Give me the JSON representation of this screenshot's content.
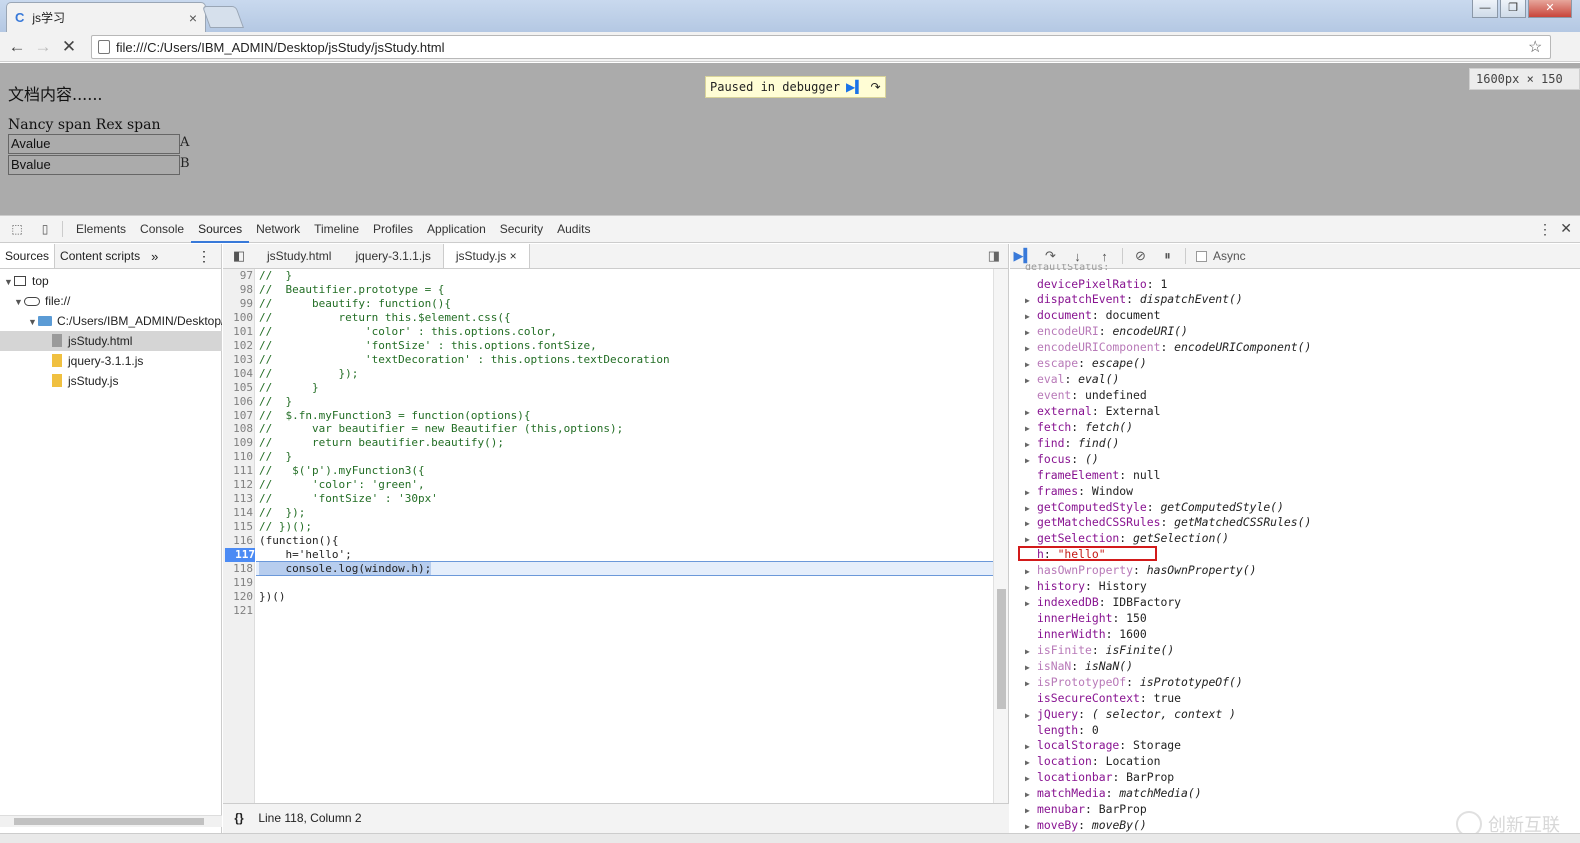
{
  "browser": {
    "tab_title": "js学习",
    "tab_close": "×",
    "url": "file:///C:/Users/IBM_ADMIN/Desktop/jsStudy/jsStudy.html",
    "win_min": "—",
    "win_max": "❐",
    "win_close": "✕"
  },
  "page": {
    "doc_text": "文档内容......",
    "spans_text": "Nancy span Rex span",
    "inputs": [
      {
        "value": "Avalue",
        "label": "A"
      },
      {
        "value": "Bvalue",
        "label": "B"
      }
    ],
    "paused_text": "Paused in debugger",
    "viewport_size": "1600px × 150"
  },
  "devtools": {
    "tabs": [
      "Elements",
      "Console",
      "Sources",
      "Network",
      "Timeline",
      "Profiles",
      "Application",
      "Security",
      "Audits"
    ],
    "active_tab": "Sources",
    "navigator": {
      "tabs": [
        "Sources",
        "Content scripts"
      ],
      "more": "»",
      "tree": [
        {
          "label": "top"
        },
        {
          "label": "file://"
        },
        {
          "label": "C:/Users/IBM_ADMIN/Desktop/jsStudy"
        },
        {
          "label": "jsStudy.html"
        },
        {
          "label": "jquery-3.1.1.js"
        },
        {
          "label": "jsStudy.js"
        }
      ]
    },
    "editor": {
      "tabs": [
        "jsStudy.html",
        "jquery-3.1.1.js",
        "jsStudy.js"
      ],
      "active_file": "jsStudy.js",
      "tab_close": "×",
      "status": "Line 118, Column 2",
      "format_button": "{}",
      "breakpoint_line": 117,
      "exec_line": 118,
      "lines": [
        {
          "n": "97",
          "text": "//  }"
        },
        {
          "n": "98",
          "text": "//  Beautifier.prototype = {"
        },
        {
          "n": "99",
          "text": "//      beautify: function(){"
        },
        {
          "n": "100",
          "text": "//          return this.$element.css({"
        },
        {
          "n": "101",
          "text": "//              'color' : this.options.color,"
        },
        {
          "n": "102",
          "text": "//              'fontSize' : this.options.fontSize,"
        },
        {
          "n": "103",
          "text": "//              'textDecoration' : this.options.textDecoration"
        },
        {
          "n": "104",
          "text": "//          });"
        },
        {
          "n": "105",
          "text": "//      }"
        },
        {
          "n": "106",
          "text": "//  }"
        },
        {
          "n": "107",
          "text": "//  $.fn.myFunction3 = function(options){"
        },
        {
          "n": "108",
          "text": "//      var beautifier = new Beautifier (this,options);"
        },
        {
          "n": "109",
          "text": "//      return beautifier.beautify();"
        },
        {
          "n": "110",
          "text": "//  }"
        },
        {
          "n": "111",
          "text": "//   $('p').myFunction3({"
        },
        {
          "n": "112",
          "text": "//      'color': 'green',"
        },
        {
          "n": "113",
          "text": "//      'fontSize' : '30px'"
        },
        {
          "n": "114",
          "text": "//  });"
        },
        {
          "n": "115",
          "text": "// })();"
        },
        {
          "n": "116",
          "text": "(function(){"
        },
        {
          "n": "117",
          "text": "    h='hello';"
        },
        {
          "n": "118",
          "text": "    console.log(window.h);"
        },
        {
          "n": "119",
          "text": ""
        },
        {
          "n": "120",
          "text": "})()"
        },
        {
          "n": "121",
          "text": ""
        }
      ]
    },
    "debugger": {
      "async_label": "Async",
      "partial_top": "defaultStatus:",
      "props": [
        {
          "name": "devicePixelRatio",
          "value": "1",
          "expand": false,
          "dim": false,
          "kind": "plain"
        },
        {
          "name": "dispatchEvent",
          "value": "dispatchEvent()",
          "expand": true,
          "dim": false,
          "kind": "fn"
        },
        {
          "name": "document",
          "value": "document",
          "expand": true,
          "dim": false,
          "kind": "plain"
        },
        {
          "name": "encodeURI",
          "value": "encodeURI()",
          "expand": true,
          "dim": true,
          "kind": "fn"
        },
        {
          "name": "encodeURIComponent",
          "value": "encodeURIComponent()",
          "expand": true,
          "dim": true,
          "kind": "fn"
        },
        {
          "name": "escape",
          "value": "escape()",
          "expand": true,
          "dim": true,
          "kind": "fn"
        },
        {
          "name": "eval",
          "value": "eval()",
          "expand": true,
          "dim": true,
          "kind": "fn"
        },
        {
          "name": "event",
          "value": "undefined",
          "expand": false,
          "dim": true,
          "kind": "plain"
        },
        {
          "name": "external",
          "value": "External",
          "expand": true,
          "dim": false,
          "kind": "plain"
        },
        {
          "name": "fetch",
          "value": "fetch()",
          "expand": true,
          "dim": false,
          "kind": "fn"
        },
        {
          "name": "find",
          "value": "find()",
          "expand": true,
          "dim": false,
          "kind": "fn"
        },
        {
          "name": "focus",
          "value": "()",
          "expand": true,
          "dim": false,
          "kind": "fn"
        },
        {
          "name": "frameElement",
          "value": "null",
          "expand": false,
          "dim": false,
          "kind": "plain"
        },
        {
          "name": "frames",
          "value": "Window",
          "expand": true,
          "dim": false,
          "kind": "plain"
        },
        {
          "name": "getComputedStyle",
          "value": "getComputedStyle()",
          "expand": true,
          "dim": false,
          "kind": "fn"
        },
        {
          "name": "getMatchedCSSRules",
          "value": "getMatchedCSSRules()",
          "expand": true,
          "dim": false,
          "kind": "fn"
        },
        {
          "name": "getSelection",
          "value": "getSelection()",
          "expand": true,
          "dim": false,
          "kind": "fn"
        },
        {
          "name": "h",
          "value": "\"hello\"",
          "expand": false,
          "dim": false,
          "kind": "str"
        },
        {
          "name": "hasOwnProperty",
          "value": "hasOwnProperty()",
          "expand": true,
          "dim": true,
          "kind": "fn"
        },
        {
          "name": "history",
          "value": "History",
          "expand": true,
          "dim": false,
          "kind": "plain"
        },
        {
          "name": "indexedDB",
          "value": "IDBFactory",
          "expand": true,
          "dim": false,
          "kind": "plain"
        },
        {
          "name": "innerHeight",
          "value": "150",
          "expand": false,
          "dim": false,
          "kind": "plain"
        },
        {
          "name": "innerWidth",
          "value": "1600",
          "expand": false,
          "dim": false,
          "kind": "plain"
        },
        {
          "name": "isFinite",
          "value": "isFinite()",
          "expand": true,
          "dim": true,
          "kind": "fn"
        },
        {
          "name": "isNaN",
          "value": "isNaN()",
          "expand": true,
          "dim": true,
          "kind": "fn"
        },
        {
          "name": "isPrototypeOf",
          "value": "isPrototypeOf()",
          "expand": true,
          "dim": true,
          "kind": "fn"
        },
        {
          "name": "isSecureContext",
          "value": "true",
          "expand": false,
          "dim": false,
          "kind": "plain"
        },
        {
          "name": "jQuery",
          "value": "( selector, context )",
          "expand": true,
          "dim": false,
          "kind": "fn"
        },
        {
          "name": "length",
          "value": "0",
          "expand": false,
          "dim": false,
          "kind": "plain"
        },
        {
          "name": "localStorage",
          "value": "Storage",
          "expand": true,
          "dim": false,
          "kind": "plain"
        },
        {
          "name": "location",
          "value": "Location",
          "expand": true,
          "dim": false,
          "kind": "plain"
        },
        {
          "name": "locationbar",
          "value": "BarProp",
          "expand": true,
          "dim": false,
          "kind": "plain"
        },
        {
          "name": "matchMedia",
          "value": "matchMedia()",
          "expand": true,
          "dim": false,
          "kind": "fn"
        },
        {
          "name": "menubar",
          "value": "BarProp",
          "expand": true,
          "dim": false,
          "kind": "plain"
        },
        {
          "name": "moveBy",
          "value": "moveBy()",
          "expand": true,
          "dim": false,
          "kind": "fn"
        }
      ]
    }
  },
  "watermark": {
    "text": "创新互联"
  },
  "colors": {
    "accent": "#3879d9",
    "breakpoint": "#4c8bf4",
    "highlight_box": "#d21a1a",
    "page_bg": "#ababab"
  }
}
